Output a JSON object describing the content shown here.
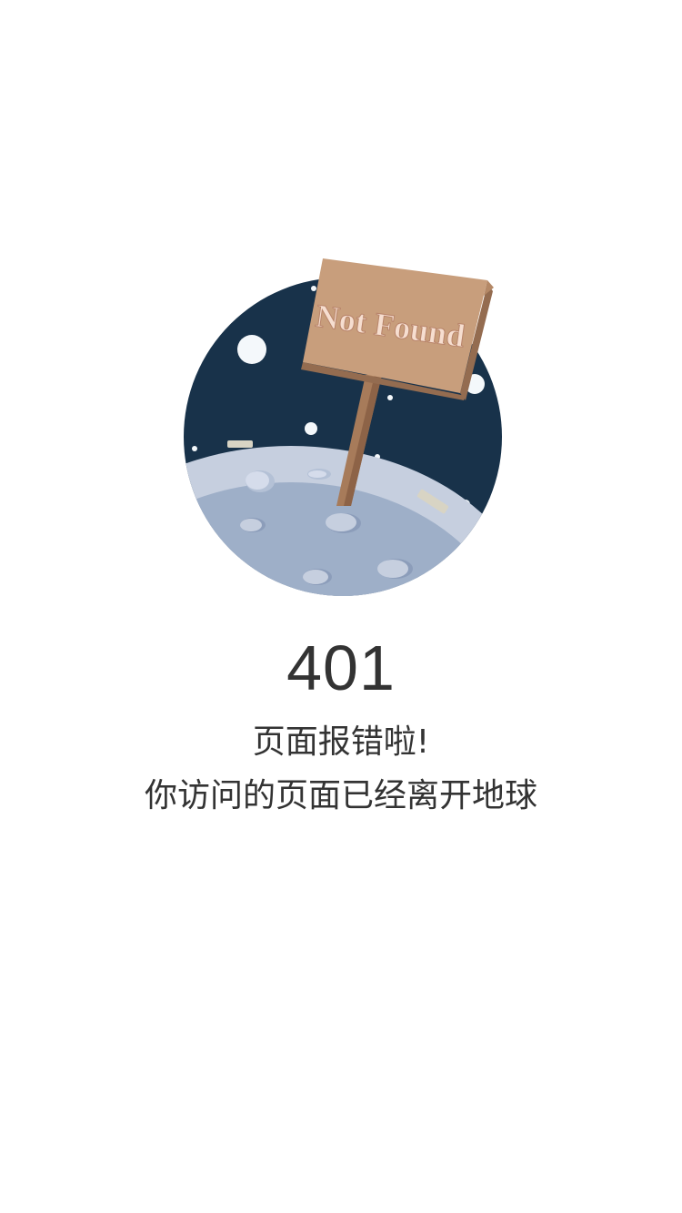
{
  "illustration": {
    "sign_text": "Not Found",
    "colors": {
      "sky": "#18324a",
      "moon_light": "#c6cfdf",
      "moon_dark": "#9eafc8",
      "sign_face": "#c89e7c",
      "sign_edge": "#946c50",
      "sign_text": "#f6ded0",
      "stars": "#f4f8fb"
    }
  },
  "error": {
    "code": "401",
    "title": "页面报错啦!",
    "message": "你访问的页面已经离开地球"
  }
}
